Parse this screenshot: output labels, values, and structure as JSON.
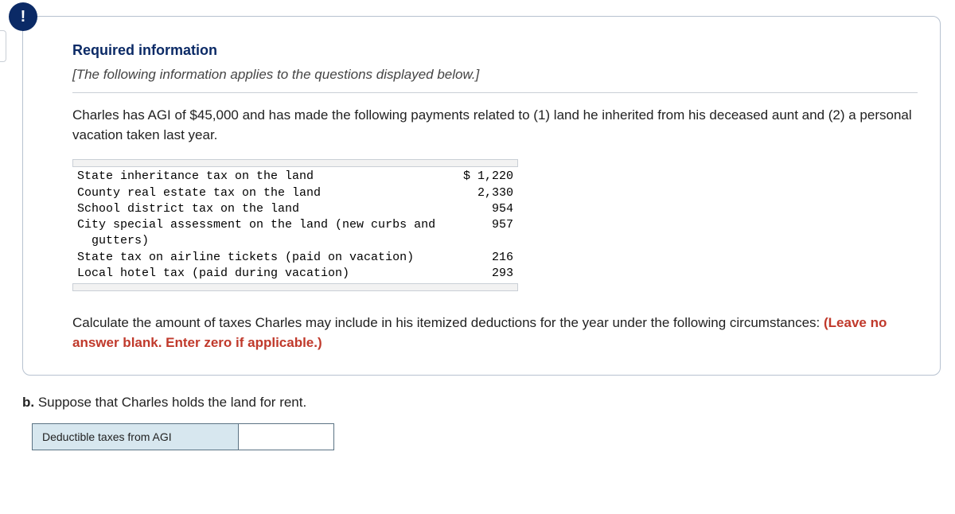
{
  "badge_symbol": "!",
  "required_title": "Required information",
  "applies_note": "[The following information applies to the questions displayed below.]",
  "intro_text": "Charles has AGI of $45,000 and has made the following payments related to (1) land he inherited from his deceased aunt and (2) a personal vacation taken last year.",
  "payments": [
    {
      "label": "State inheritance tax on the land",
      "amount": "$ 1,220"
    },
    {
      "label": "County real estate tax on the land",
      "amount": "2,330"
    },
    {
      "label": "School district tax on the land",
      "amount": "954"
    },
    {
      "label": "City special assessment on the land (new curbs and\n  gutters)",
      "amount": "957"
    },
    {
      "label": "State tax on airline tickets (paid on vacation)",
      "amount": "216"
    },
    {
      "label": "Local hotel tax (paid during vacation)",
      "amount": "293"
    }
  ],
  "calc_prefix": "Calculate the amount of taxes Charles may include in his itemized deductions for the year under the following circumstances: ",
  "calc_warn": "(Leave no answer blank. Enter zero if applicable.)",
  "part_b_label": "b.",
  "part_b_text": " Suppose that Charles holds the land for rent.",
  "answer_label": "Deductible taxes from AGI",
  "answer_value": ""
}
